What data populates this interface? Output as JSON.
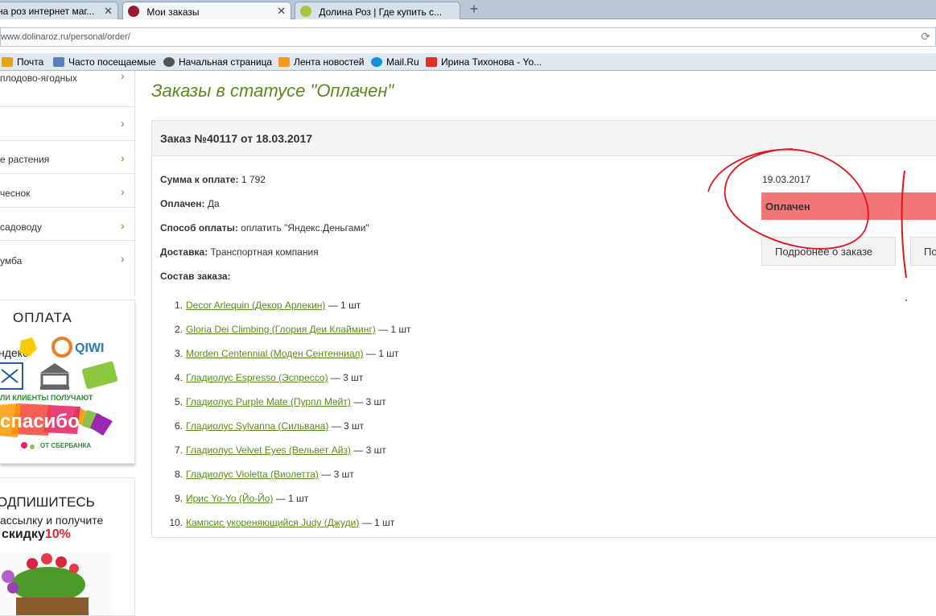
{
  "browser": {
    "tabs": [
      {
        "label": "на роз интернет маг..."
      },
      {
        "label": "Мои заказы"
      },
      {
        "label": "Долина Роз | Где купить с..."
      }
    ],
    "new_tab": "+",
    "close": "✕",
    "url": "www.dolinaroz.ru/personal/order/",
    "bookmarks": [
      {
        "label": "Почта",
        "icon": "mail-icon"
      },
      {
        "label": "Часто посещаемые",
        "icon": "bookmark-icon"
      },
      {
        "label": "Начальная страница",
        "icon": "globe-icon"
      },
      {
        "label": "Лента новостей",
        "icon": "rss-icon"
      },
      {
        "label": "Mail.Ru",
        "icon": "mailru-icon"
      },
      {
        "label": "Ирина Тихонова - Yo...",
        "icon": "youtube-icon"
      }
    ]
  },
  "sidebar": {
    "items": [
      {
        "label": "плодово-ягодных"
      },
      {
        "label": ""
      },
      {
        "label": "е растения"
      },
      {
        "label": "чеснок"
      },
      {
        "label": "садоводу"
      },
      {
        "label": "умба"
      }
    ],
    "chevron": "›",
    "payment": {
      "title": "ОПЛАТА",
      "yandex": "ндекс",
      "qiwi": "QIWI",
      "clients_text": "ЛИ КЛИЕНТЫ ПОЛУЧАЮТ",
      "spasibo": "спасибо",
      "sberbank": "ОТ СБЕРБАНКА"
    },
    "subscribe": {
      "title": "ОДПИШИТЕСЬ",
      "text": "ассылку и получите",
      "discount_prefix": "скидку",
      "discount_value": "10%"
    }
  },
  "main": {
    "heading": "Заказы в статусе \"Оплачен\"",
    "order": {
      "title": "Заказ №40117 от 18.03.2017",
      "sum_label": "Сумма к оплате:",
      "sum_value": "1 792",
      "paid_label": "Оплачен:",
      "paid_value": "Да",
      "payment_label": "Способ оплаты:",
      "payment_value": "оплатить \"Яндекс.Деньгами\"",
      "delivery_label": "Доставка:",
      "delivery_value": "Транспортная компания",
      "contents_label": "Состав заказа:",
      "items": [
        {
          "num": "1.",
          "name": "Decor Arlequin (Декор Арлекин)",
          "qty": "— 1 шт"
        },
        {
          "num": "2.",
          "name": "Gloria Dei Climbing (Глория Деи Клайминг)",
          "qty": "— 1 шт"
        },
        {
          "num": "3.",
          "name": "Morden Centennial (Моден Сентенниал)",
          "qty": "— 1 шт"
        },
        {
          "num": "4.",
          "name": "Гладиолус Espresso (Эспрессо)",
          "qty": "— 3 шт"
        },
        {
          "num": "5.",
          "name": "Гладиолус Purple Mate (Пурпл Мейт)",
          "qty": "— 3 шт"
        },
        {
          "num": "6.",
          "name": "Гладиолус Sylvanna (Сильвана)",
          "qty": "— 3 шт"
        },
        {
          "num": "7.",
          "name": "Гладиолус Velvet Eyes (Вельвет Айз)",
          "qty": "— 3 шт"
        },
        {
          "num": "8.",
          "name": "Гладиолус Violetta (Виолетта)",
          "qty": "— 3 шт"
        },
        {
          "num": "9.",
          "name": "Ирис Yo-Yo (Йо-Йо)",
          "qty": "— 1 шт"
        },
        {
          "num": "10.",
          "name": "Кампсис укореняющийся Judy (Джуди)",
          "qty": "— 1 шт"
        }
      ],
      "status_date": "19.03.2017",
      "status": "Оплачен",
      "details_button": "Подробнее о заказе",
      "second_button": "По"
    }
  },
  "colors": {
    "accent_green": "#5b8a19",
    "status_red": "#f37575",
    "annotation_red": "#e0141c"
  }
}
